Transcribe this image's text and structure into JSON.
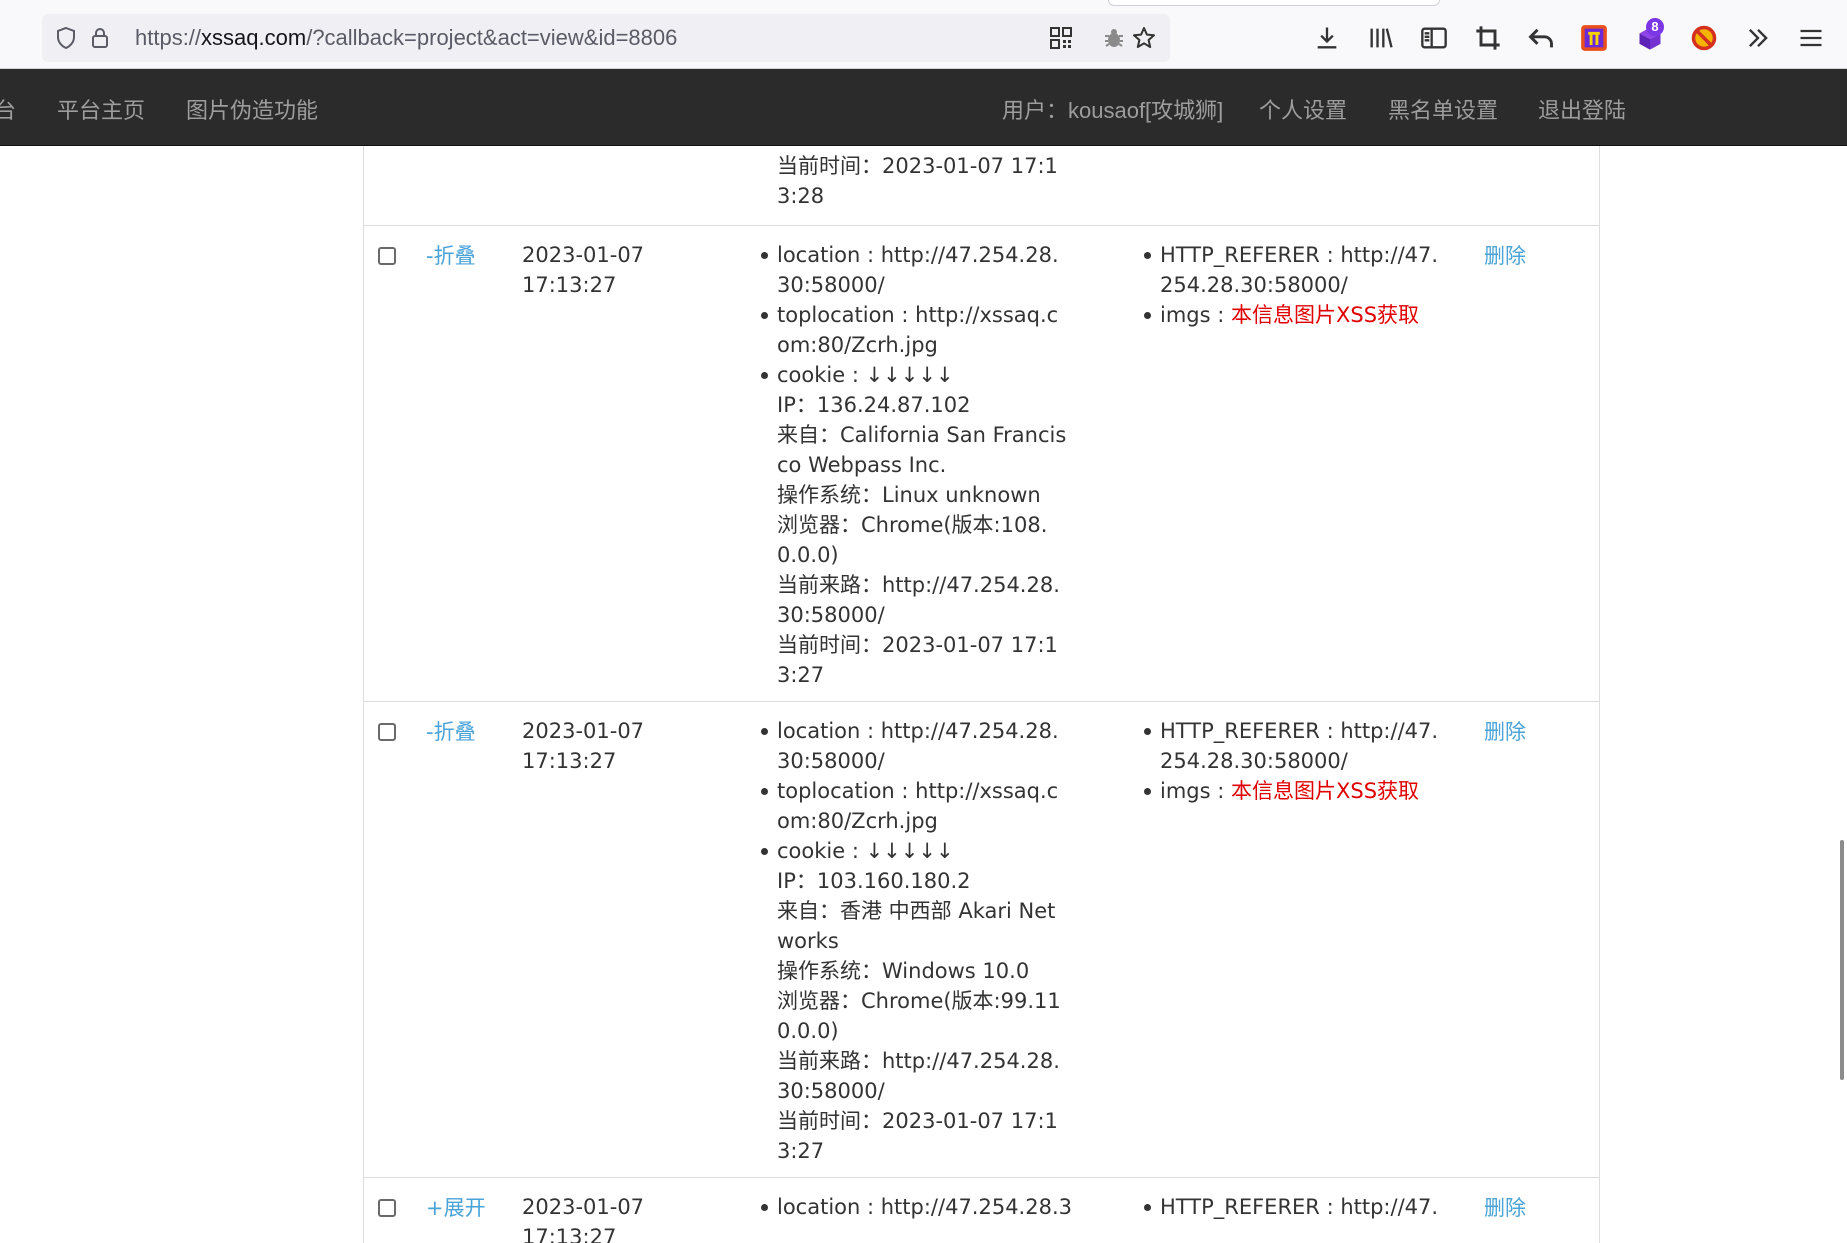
{
  "browser": {
    "url_prefix": "https://",
    "url_host": "xssaq.com",
    "url_path": "/?callback=project&act=view&id=8806",
    "extension_badge": "8"
  },
  "nav": {
    "brand_fragment": "台",
    "home": "平台主页",
    "image_forge": "图片伪造功能",
    "user": "用户：kousaof[攻城狮]",
    "settings": "个人设置",
    "blacklist": "黑名单设置",
    "logout": "退出登陆"
  },
  "top_fragment": "当前时间：2023-01-07 17:13:28",
  "rows": [
    {
      "toggle": "-折叠",
      "date": "2023-01-07\n17:13:27",
      "location": "location : http://47.254.28.30:58000/",
      "toplocation": "toplocation : http://xssaq.com:80/Zcrh.jpg",
      "cookie": "cookie : ↓↓↓↓↓",
      "ip": "IP：136.24.87.102",
      "from": "来自：California San Francisco Webpass Inc.",
      "os": "操作系统：Linux unknown",
      "browser": "浏览器：Chrome(版本:108.0.0.0)",
      "referer_line": "当前来路：http://47.254.28.30:58000/",
      "time": "当前时间：2023-01-07 17:13:27",
      "http_referer": "HTTP_REFERER : http://47.254.28.30:58000/",
      "imgs_label": "imgs : ",
      "imgs_value": "本信息图片XSS获取",
      "delete": "删除"
    },
    {
      "toggle": "-折叠",
      "date": "2023-01-07\n17:13:27",
      "location": "location : http://47.254.28.30:58000/",
      "toplocation": "toplocation : http://xssaq.com:80/Zcrh.jpg",
      "cookie": "cookie : ↓↓↓↓↓",
      "ip": "IP：103.160.180.2",
      "from": "来自：香港 中西部 Akari Networks",
      "os": "操作系统：Windows 10.0",
      "browser": "浏览器：Chrome(版本:99.110.0.0)",
      "referer_line": "当前来路：http://47.254.28.30:58000/",
      "time": "当前时间：2023-01-07 17:13:27",
      "http_referer": "HTTP_REFERER : http://47.254.28.30:58000/",
      "imgs_label": "imgs : ",
      "imgs_value": "本信息图片XSS获取",
      "delete": "删除"
    },
    {
      "toggle": "+展开",
      "date": "2023-01-07\n17:13:27",
      "location": "location : http://47.254.28.3",
      "http_referer": "HTTP_REFERER : http://47.",
      "delete": "删除"
    }
  ]
}
